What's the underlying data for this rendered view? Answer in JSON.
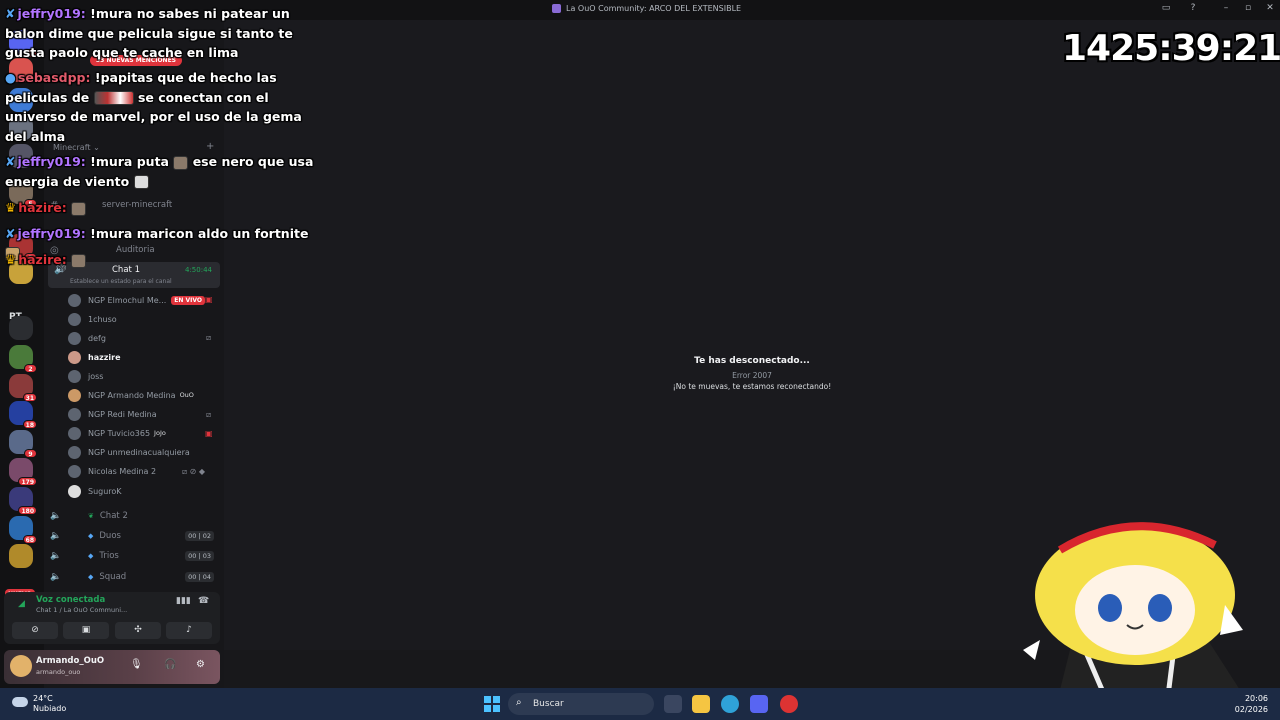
{
  "window": {
    "title": "La OuO Community: ARCO DEL EXTENSIBLE"
  },
  "overlay": {
    "timer": "1425:39:21",
    "chat": [
      {
        "user": "jeffry019:",
        "color": "#b174ff",
        "text": "!mura no sabes ni patear un balon dime que pelicula sigue si tanto te gusta paolo que te cache en lima"
      },
      {
        "user": "sebasdpp:",
        "color": "#e05a6a",
        "text": "!papitas que de hecho las peliculas de",
        "text2": "se conectan con el universo de marvel, por el uso de la gema del alma"
      },
      {
        "user": "jeffry019:",
        "color": "#b174ff",
        "text": "!mura puta",
        "text2": "ese nero que usa energia de viento"
      },
      {
        "user": "hazire:",
        "color": "#e0343c",
        "text": ""
      },
      {
        "user": "jeffry019:",
        "color": "#b174ff",
        "text": "!mura maricon aldo un fortnite"
      },
      {
        "user": "hazire:",
        "color": "#e0343c",
        "text": ""
      }
    ]
  },
  "servers": {
    "badges": [
      "67",
      "5",
      "3",
      "2",
      "31",
      "18",
      "9",
      "179",
      "180",
      "68"
    ],
    "pt_label": "PT",
    "new_label": "NUEVO"
  },
  "sidebar": {
    "mentions_pill": "33 NUEVAS MENCIONES",
    "category": "Minecraft",
    "channels": [
      {
        "name": "server-minecraft"
      },
      {
        "name": "Auditoria"
      }
    ],
    "active_channel": {
      "name": "Chat 1",
      "time": "4:50:44",
      "status": "Establece un estado para el canal"
    },
    "voice_users": [
      {
        "name": "NGP Elmochul Me...",
        "live": "EN VIVO"
      },
      {
        "name": "1chuso"
      },
      {
        "name": "defg"
      },
      {
        "name": "hazzire"
      },
      {
        "name": "joss"
      },
      {
        "name": "NGP Armando Medina",
        "tag": "OuO"
      },
      {
        "name": "NGP Redi Medina"
      },
      {
        "name": "NGP Tuvicio365",
        "tag": "JoJo"
      },
      {
        "name": "NGP unmedinacualquiera"
      },
      {
        "name": "Nicolas Medina 2"
      },
      {
        "name": "SuguroK"
      }
    ],
    "voice_channels": [
      {
        "name": "Chat 2",
        "count": ""
      },
      {
        "name": "Duos",
        "count": "00 | 02"
      },
      {
        "name": "Trios",
        "count": "00 | 03"
      },
      {
        "name": "Squad",
        "count": "00 | 04"
      }
    ]
  },
  "voice_panel": {
    "title": "Voz conectada",
    "subtitle": "Chat 1 / La OuO Communi..."
  },
  "user_panel": {
    "name": "Armando_OuO",
    "handle": "armando_ouo"
  },
  "main": {
    "disconnect_title": "Te has desconectado...",
    "error_code": "Error 2007",
    "message": "¡No te muevas, te estamos reconectando!"
  },
  "taskbar": {
    "temperature": "24°C",
    "weather": "Nubiado",
    "search_placeholder": "Buscar",
    "time": "20:06",
    "date": "02/2026"
  },
  "colors": {
    "accent_blue": "#4cc2ff",
    "live_red": "#e0343c",
    "voice_green": "#23a55a"
  }
}
